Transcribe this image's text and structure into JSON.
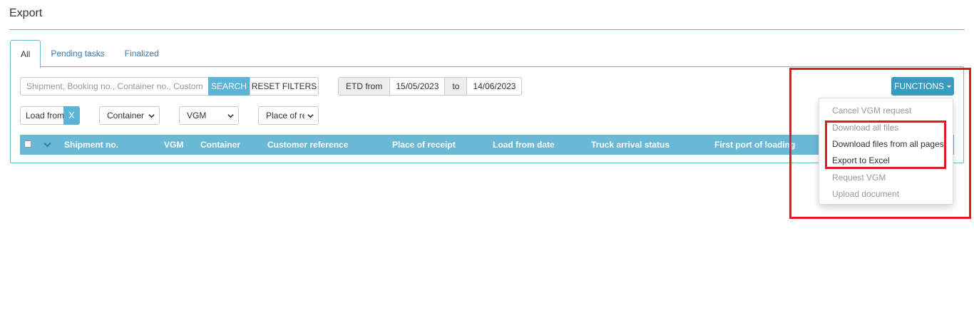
{
  "page": {
    "title": "Export"
  },
  "tabs": [
    {
      "label": "All",
      "active": true
    },
    {
      "label": "Pending tasks",
      "active": false
    },
    {
      "label": "Finalized",
      "active": false
    }
  ],
  "filters": {
    "search_placeholder": "Shipment, Booking no., Container no., Customer reference",
    "search_button": "SEARCH",
    "reset_button": "RESET FILTERS",
    "etd_from_label": "ETD from",
    "etd_from_value": "15/05/2023",
    "etd_to_label": "to",
    "etd_to_value": "14/06/2023",
    "load_from_value": "Load from date",
    "clear_label": "X",
    "container_select": "Container",
    "vgm_select": "VGM",
    "place_select": "Place of receipt"
  },
  "table": {
    "columns": [
      "Shipment no.",
      "VGM",
      "Container",
      "Customer reference",
      "Place of receipt",
      "Load from date",
      "Truck arrival status",
      "First port of loading"
    ]
  },
  "functions": {
    "button_label": "FUNCTIONS",
    "menu": [
      {
        "label": "Cancel VGM request",
        "enabled": false
      },
      {
        "label": "Download all files",
        "enabled": false
      },
      {
        "label": "Download files from all pages",
        "enabled": true
      },
      {
        "label": "Export to Excel",
        "enabled": true
      },
      {
        "label": "Request VGM",
        "enabled": false
      },
      {
        "label": "Upload document",
        "enabled": false
      }
    ]
  },
  "colors": {
    "accent": "#5bb4d6",
    "header": "#69b9d6",
    "functions": "#3a9bc0",
    "annotation": "#e11b22"
  }
}
